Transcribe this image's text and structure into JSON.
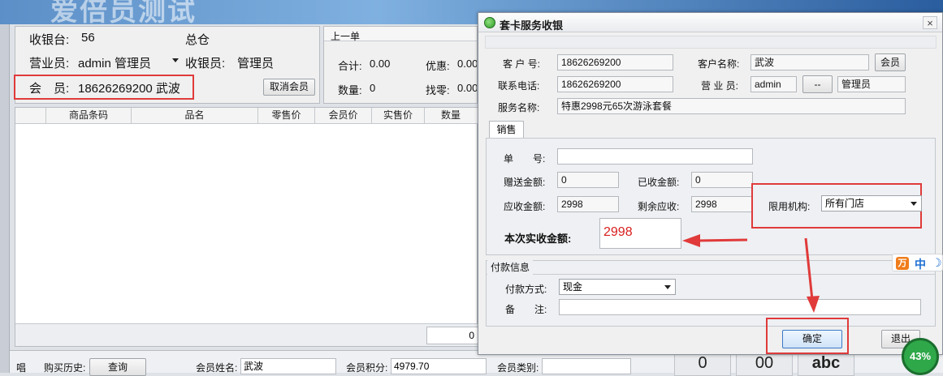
{
  "background_app": {
    "banner_text": "爱倍员测试",
    "info": {
      "register_label": "收银台:",
      "register_value": "56",
      "store": "总仓",
      "salesperson_label": "营业员:",
      "salesperson_value": "admin 管理员",
      "cashier_label": "收银员:",
      "cashier_value": "管理员",
      "member_label": "会　员:",
      "member_value": "18626269200 武波",
      "cancel_member_button": "取消会员"
    },
    "summary": {
      "last_order": "上一单",
      "total_label": "合计:",
      "total_value": "0.00",
      "discount_label": "优惠:",
      "discount_value": "0.00",
      "qty_label": "数量:",
      "qty_value": "0",
      "change_label": "找零:",
      "change_value": "0.00"
    },
    "grid": {
      "columns": [
        "",
        "商品条码",
        "品名",
        "零售价",
        "会员价",
        "实售价",
        "数量"
      ],
      "footer_value": "0"
    },
    "bottom_bar": {
      "side_label": "唱",
      "history_label": "购买历史:",
      "query_button": "查询",
      "member_name_label": "会员姓名:",
      "member_name_value": "武波",
      "points_label": "会员积分:",
      "points_value": "4979.70",
      "member_type_label": "会员类别:",
      "member_type_value": ""
    },
    "keypad": [
      "0",
      "00",
      "abc"
    ]
  },
  "dialog": {
    "title": "套卡服务收银",
    "close_glyph": "×",
    "customer_no_label": "客 户 号:",
    "customer_no": "18626269200",
    "customer_name_label": "客户名称:",
    "customer_name": "武波",
    "member_button": "会员",
    "phone_label": "联系电话:",
    "phone": "18626269200",
    "salesperson_label": "营 业 员:",
    "salesperson_code": "admin",
    "salesperson_pick_button": "--",
    "salesperson_name": "管理员",
    "service_label": "服务名称:",
    "service_name": "特惠2998元65次游泳套餐",
    "tab_sale": "销售",
    "order_no_label": "单　　号:",
    "order_no": "",
    "gift_amount_label": "赠送金额:",
    "gift_amount": "0",
    "received_label": "已收金额:",
    "received": "0",
    "receivable_label": "应收金额:",
    "receivable": "2998",
    "remaining_label": "剩余应收:",
    "remaining": "2998",
    "limit_org_label": "限用机构:",
    "limit_org_value": "所有门店",
    "actual_amount_label": "本次实收金额:",
    "actual_amount": "2998",
    "payment_section_title": "付款信息",
    "payment_method_label": "付款方式:",
    "payment_method_value": "现金",
    "note_label": "备　　注:",
    "note_value": "",
    "confirm_button": "确定",
    "exit_button": "退出"
  },
  "overlay": {
    "ime_logo": "万",
    "ime_mode": "中",
    "ime_moon": "☽",
    "usage_badge": "43%"
  },
  "colors": {
    "highlight_red": "#e03a3a",
    "amount_red": "#d81e1e",
    "badge_green": "#2fa84a"
  }
}
